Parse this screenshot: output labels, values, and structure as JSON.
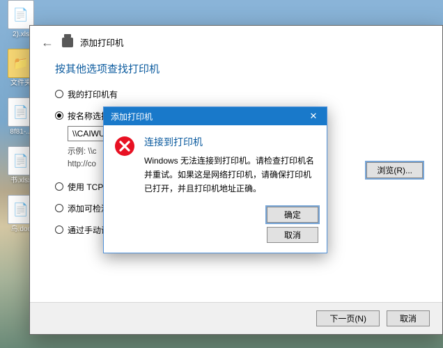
{
  "desktop": {
    "icons": [
      {
        "label": "2).xls",
        "shape": "file"
      },
      {
        "label": "文件夹",
        "shape": "folder"
      },
      {
        "label": "8f81-...",
        "shape": "file"
      },
      {
        "label": "书.xlsx",
        "shape": "file"
      },
      {
        "label": "鸟.doc",
        "shape": "file"
      }
    ]
  },
  "wizard": {
    "title": "添加打印机",
    "section_title": "按其他选项查找打印机",
    "options": {
      "opt0": "我的打印机有",
      "opt1": "按名称选择共",
      "opt2": "使用 TCP/IP 地",
      "opt3": "添加可检测到蓝牙、无线或网络的打印机(L)",
      "opt4": "通过手动设置添加本地打印机或网络打印机(O)"
    },
    "name_input_value": "\\\\CAIWU",
    "hint_line1": "示例: \\\\c",
    "hint_line2": "http://co",
    "browse_label": "浏览(R)...",
    "footer": {
      "next": "下一页(N)",
      "cancel": "取消"
    }
  },
  "error": {
    "titlebar": "添加打印机",
    "close": "✕",
    "heading": "连接到打印机",
    "message": "Windows 无法连接到打印机。请检查打印机名并重试。如果这是网络打印机，请确保打印机已打开，并且打印机地址正确。",
    "ok": "确定",
    "cancel": "取消"
  }
}
